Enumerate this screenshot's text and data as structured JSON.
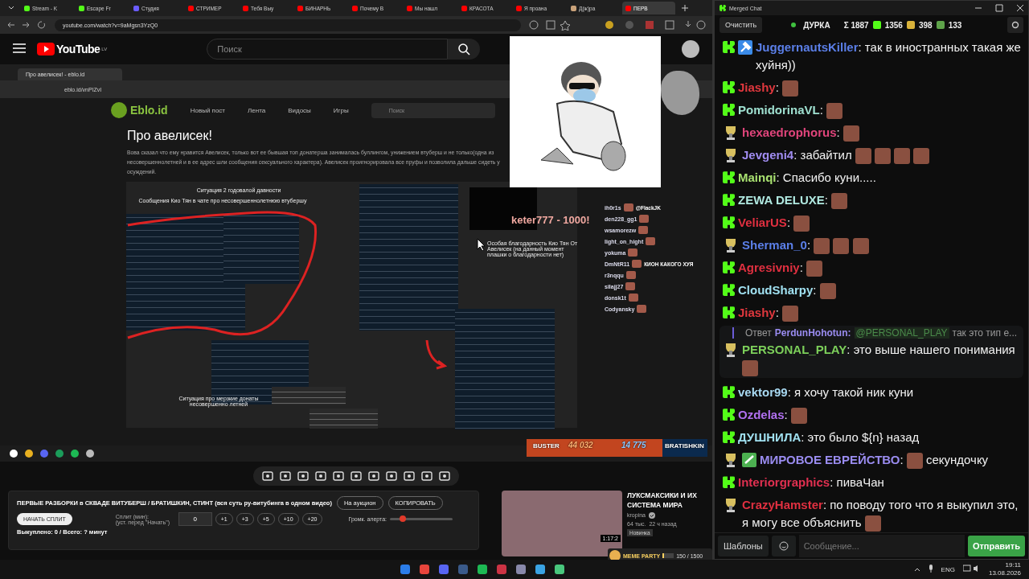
{
  "browser": {
    "tabs": [
      {
        "label": "Stream - K",
        "kind": "kick",
        "selected": false
      },
      {
        "label": "Escape Fr",
        "kind": "kick",
        "selected": false
      },
      {
        "label": "Студия",
        "kind": "studio",
        "selected": false
      },
      {
        "label": "СТРИМЕР",
        "kind": "video",
        "selected": false
      },
      {
        "label": "Тебя Выу",
        "kind": "video",
        "selected": false
      },
      {
        "label": "БИНАРНЬ",
        "kind": "video",
        "selected": false
      },
      {
        "label": "Почему В",
        "kind": "video",
        "selected": false
      },
      {
        "label": "Мы нашл",
        "kind": "video",
        "selected": false
      },
      {
        "label": "КРАСОТА",
        "kind": "video",
        "selected": false
      },
      {
        "label": "Я проана",
        "kind": "video",
        "selected": false
      },
      {
        "label": "Д(ж)ра",
        "kind": "person",
        "selected": false
      },
      {
        "label": "ПЕРВ",
        "kind": "video",
        "selected": true
      }
    ],
    "url": "youtube.com/watch?v=9aMgsn3YzQ0"
  },
  "youtube": {
    "logo": "YouTube",
    "region": "LV",
    "search_placeholder": "Поиск"
  },
  "stream": {
    "inner_browser": {
      "tab": "Про авелисек! - eblo.id",
      "url": "eblo.id/vnPIZvI"
    },
    "site": {
      "logo": "Eblo.id",
      "nav": [
        "Новый пост",
        "Лента",
        "Видосы",
        "Игры"
      ],
      "search_placeholder": "Поиск"
    },
    "article": {
      "title": "Про авелисек!",
      "body": "Вова сказал что ему нравится Авелисек, только вот ее бывшая топ донатерша занималась буллингом, унижением втуберш и не только(одна из несовершеннолетней и в ее адрес шли сообщения сексуального характера). Авелисек проигнорировала все пруфы и позволила дальше сидеть у осуждений.",
      "captions": [
        "Ситуация 2 годовалой давности",
        "Сообщения Кио Тян в чате про несовершеннолетнюю втубершу",
        "Особая благодарность Кио Тян От Авелисек (на данный момент плашки о благодарности нет)",
        "Ситуация про мерзкие донаты несовершенно летней"
      ]
    },
    "overlay": {
      "donation": "keter777 - 1000!",
      "viewers": [
        {
          "name": "ih0r1s",
          "extra": "@FlackJK"
        },
        {
          "name": "den228_gg1"
        },
        {
          "name": "wsamorezw"
        },
        {
          "name": "light_on_hight"
        },
        {
          "name": "yokuma"
        },
        {
          "name": "DmNtR11",
          "extra": "КИОН КАКОГО ХУЯ"
        },
        {
          "name": "r3nqqu"
        },
        {
          "name": "silajj27"
        },
        {
          "name": "donsk1t"
        },
        {
          "name": "Codyansky"
        }
      ]
    },
    "battle": {
      "left_name": "BUSTER",
      "left_score": "44 032",
      "right_score": "14 775",
      "right_name": "BRATISHKIN",
      "level": 0.75
    }
  },
  "auction": {
    "title": "ПЕРВЫЕ РАЗБОРКИ в СКВАДЕ ВИТУБЕРШ / БРАТИШКИН, СТИНТ (вся суть ру-витубинга в одном видео)",
    "to_auction": "На аукцион",
    "copy": "КОПИРОВАТЬ",
    "start": "НАЧАТЬ СПЛИТ",
    "split_label": "Сплит (мин):",
    "split_hint": "(уст. перед \"Начать\")",
    "split_value": "0",
    "increments": [
      "+1",
      "+3",
      "+5",
      "+10",
      "+20"
    ],
    "volume_label": "Громк. алерта:",
    "volume": {
      "level": 0.2
    },
    "summary": "Выкуплено: 0 / Всего: ? минут"
  },
  "recommended": {
    "title": "ЛУКСМАКСИКИ И ИХ СИСТЕМА МИРА",
    "channel": "kropina",
    "verified": true,
    "views": "64 тыс.",
    "age": "22 ч назад",
    "badge": "Новинка",
    "duration": "1:17:2"
  },
  "meme_party": {
    "label": "MEME PARTY",
    "progress": "150 / 1500",
    "level": 0.1
  },
  "chat": {
    "title": "Merged Chat",
    "clear": "Очистить",
    "live": true,
    "channel": "ДУРКА",
    "total": "Σ 1887",
    "counts": [
      {
        "kind": "kick",
        "value": "1356"
      },
      {
        "kind": "crescent",
        "value": "398"
      },
      {
        "kind": "frog",
        "value": "133"
      }
    ],
    "messages": [
      {
        "kind": "kick",
        "badge": {
          "kind": "mod"
        },
        "user": "JuggernautsKiller",
        "color": "#5b7fe8",
        "parts": [
          {
            "kind": "text",
            "text": ": так в иностранных такая же хуйня))"
          }
        ]
      },
      {
        "kind": "kick",
        "user": "Jiashy",
        "color": "#e0383e",
        "parts": [
          {
            "kind": "text",
            "text": ":"
          },
          {
            "kind": "emote"
          }
        ]
      },
      {
        "kind": "kick",
        "user": "PomidorinaVL",
        "color": "#9fe0d0",
        "parts": [
          {
            "kind": "text",
            "text": ":"
          },
          {
            "kind": "emote"
          }
        ]
      },
      {
        "kind": "trophy",
        "user": "hexaedrophorus",
        "color": "#e0457b",
        "parts": [
          {
            "kind": "text",
            "text": ":"
          },
          {
            "kind": "emote"
          }
        ]
      },
      {
        "kind": "trophy",
        "user": "Jevgeni4",
        "color": "#a08cf0",
        "parts": [
          {
            "kind": "text",
            "text": ": забайтил"
          },
          {
            "kind": "emote"
          },
          {
            "kind": "emote"
          },
          {
            "kind": "emote"
          },
          {
            "kind": "emote"
          }
        ]
      },
      {
        "kind": "kick",
        "user": "Mainqi",
        "color": "#a8e070",
        "parts": [
          {
            "kind": "text",
            "text": ": Спасибо куни....."
          }
        ]
      },
      {
        "kind": "kick",
        "user": "ZEWA DELUXE",
        "color": "#b0e8e0",
        "parts": [
          {
            "kind": "text",
            "text": ":"
          },
          {
            "kind": "emote"
          }
        ]
      },
      {
        "kind": "kick",
        "user": "VeliarUS",
        "color": "#e03040",
        "parts": [
          {
            "kind": "text",
            "text": ":"
          },
          {
            "kind": "emote"
          }
        ]
      },
      {
        "kind": "trophy",
        "user": "Sherman_0",
        "color": "#5b7fe8",
        "parts": [
          {
            "kind": "text",
            "text": ":"
          },
          {
            "kind": "emote"
          },
          {
            "kind": "emote"
          },
          {
            "kind": "emote"
          }
        ]
      },
      {
        "kind": "kick",
        "user": "Agresivniy",
        "color": "#e03040",
        "parts": [
          {
            "kind": "text",
            "text": ":"
          },
          {
            "kind": "emote"
          }
        ]
      },
      {
        "kind": "kick",
        "user": "CloudSharpy",
        "color": "#a0e0f0",
        "parts": [
          {
            "kind": "text",
            "text": ":"
          },
          {
            "kind": "emote"
          }
        ]
      },
      {
        "kind": "kick",
        "user": "Jiashy",
        "color": "#e0383e",
        "parts": [
          {
            "kind": "text",
            "text": ":"
          },
          {
            "kind": "emote"
          }
        ]
      },
      {
        "kind": "trophy",
        "user": "PERSONAL_PLAY",
        "color": "#7ccf5a",
        "reply": {
          "label": "Ответ",
          "user": "PerdunHohotun:",
          "mention": "@PERSONAL_PLAY",
          "text": "так это тип е..."
        },
        "parts": [
          {
            "kind": "text",
            "text": ": это выше нашего понимания"
          },
          {
            "kind": "emote"
          }
        ]
      },
      {
        "kind": "kick",
        "user": "vektor99",
        "color": "#a8d8f0",
        "parts": [
          {
            "kind": "text",
            "text": ": я хочу такой ник куни"
          }
        ]
      },
      {
        "kind": "kick",
        "user": "Ozdelas",
        "color": "#b070f0",
        "parts": [
          {
            "kind": "text",
            "text": ":"
          },
          {
            "kind": "emote"
          }
        ]
      },
      {
        "kind": "kick",
        "user": "ДУШНИЛА",
        "color": "#a0e0f0",
        "parts": [
          {
            "kind": "text",
            "text": ": это было ${n} назад"
          }
        ]
      },
      {
        "kind": "trophy",
        "badge": {
          "kind": "check"
        },
        "user": "МИРОВОЕ ЕВРЕЙСТВО",
        "color": "#9a8cf0",
        "parts": [
          {
            "kind": "text",
            "text": ":"
          },
          {
            "kind": "emote"
          },
          {
            "kind": "text",
            "text": "секундочку"
          }
        ]
      },
      {
        "kind": "kick",
        "user": "Interiorgraphics",
        "color": "#e03050",
        "parts": [
          {
            "kind": "text",
            "text": ": пиваЧан"
          }
        ]
      },
      {
        "kind": "trophy",
        "user": "CrazyHamster",
        "color": "#e03040",
        "parts": [
          {
            "kind": "text",
            "text": ": по поводу того что я выкупил это, я могу все объяснить"
          },
          {
            "kind": "emote"
          }
        ]
      }
    ],
    "templates": "Шаблоны",
    "input_placeholder": "Сообщение...",
    "send": "Отправить"
  },
  "taskbar": {
    "language": "ENG",
    "time": "19:11",
    "date": "13.08.2026"
  }
}
